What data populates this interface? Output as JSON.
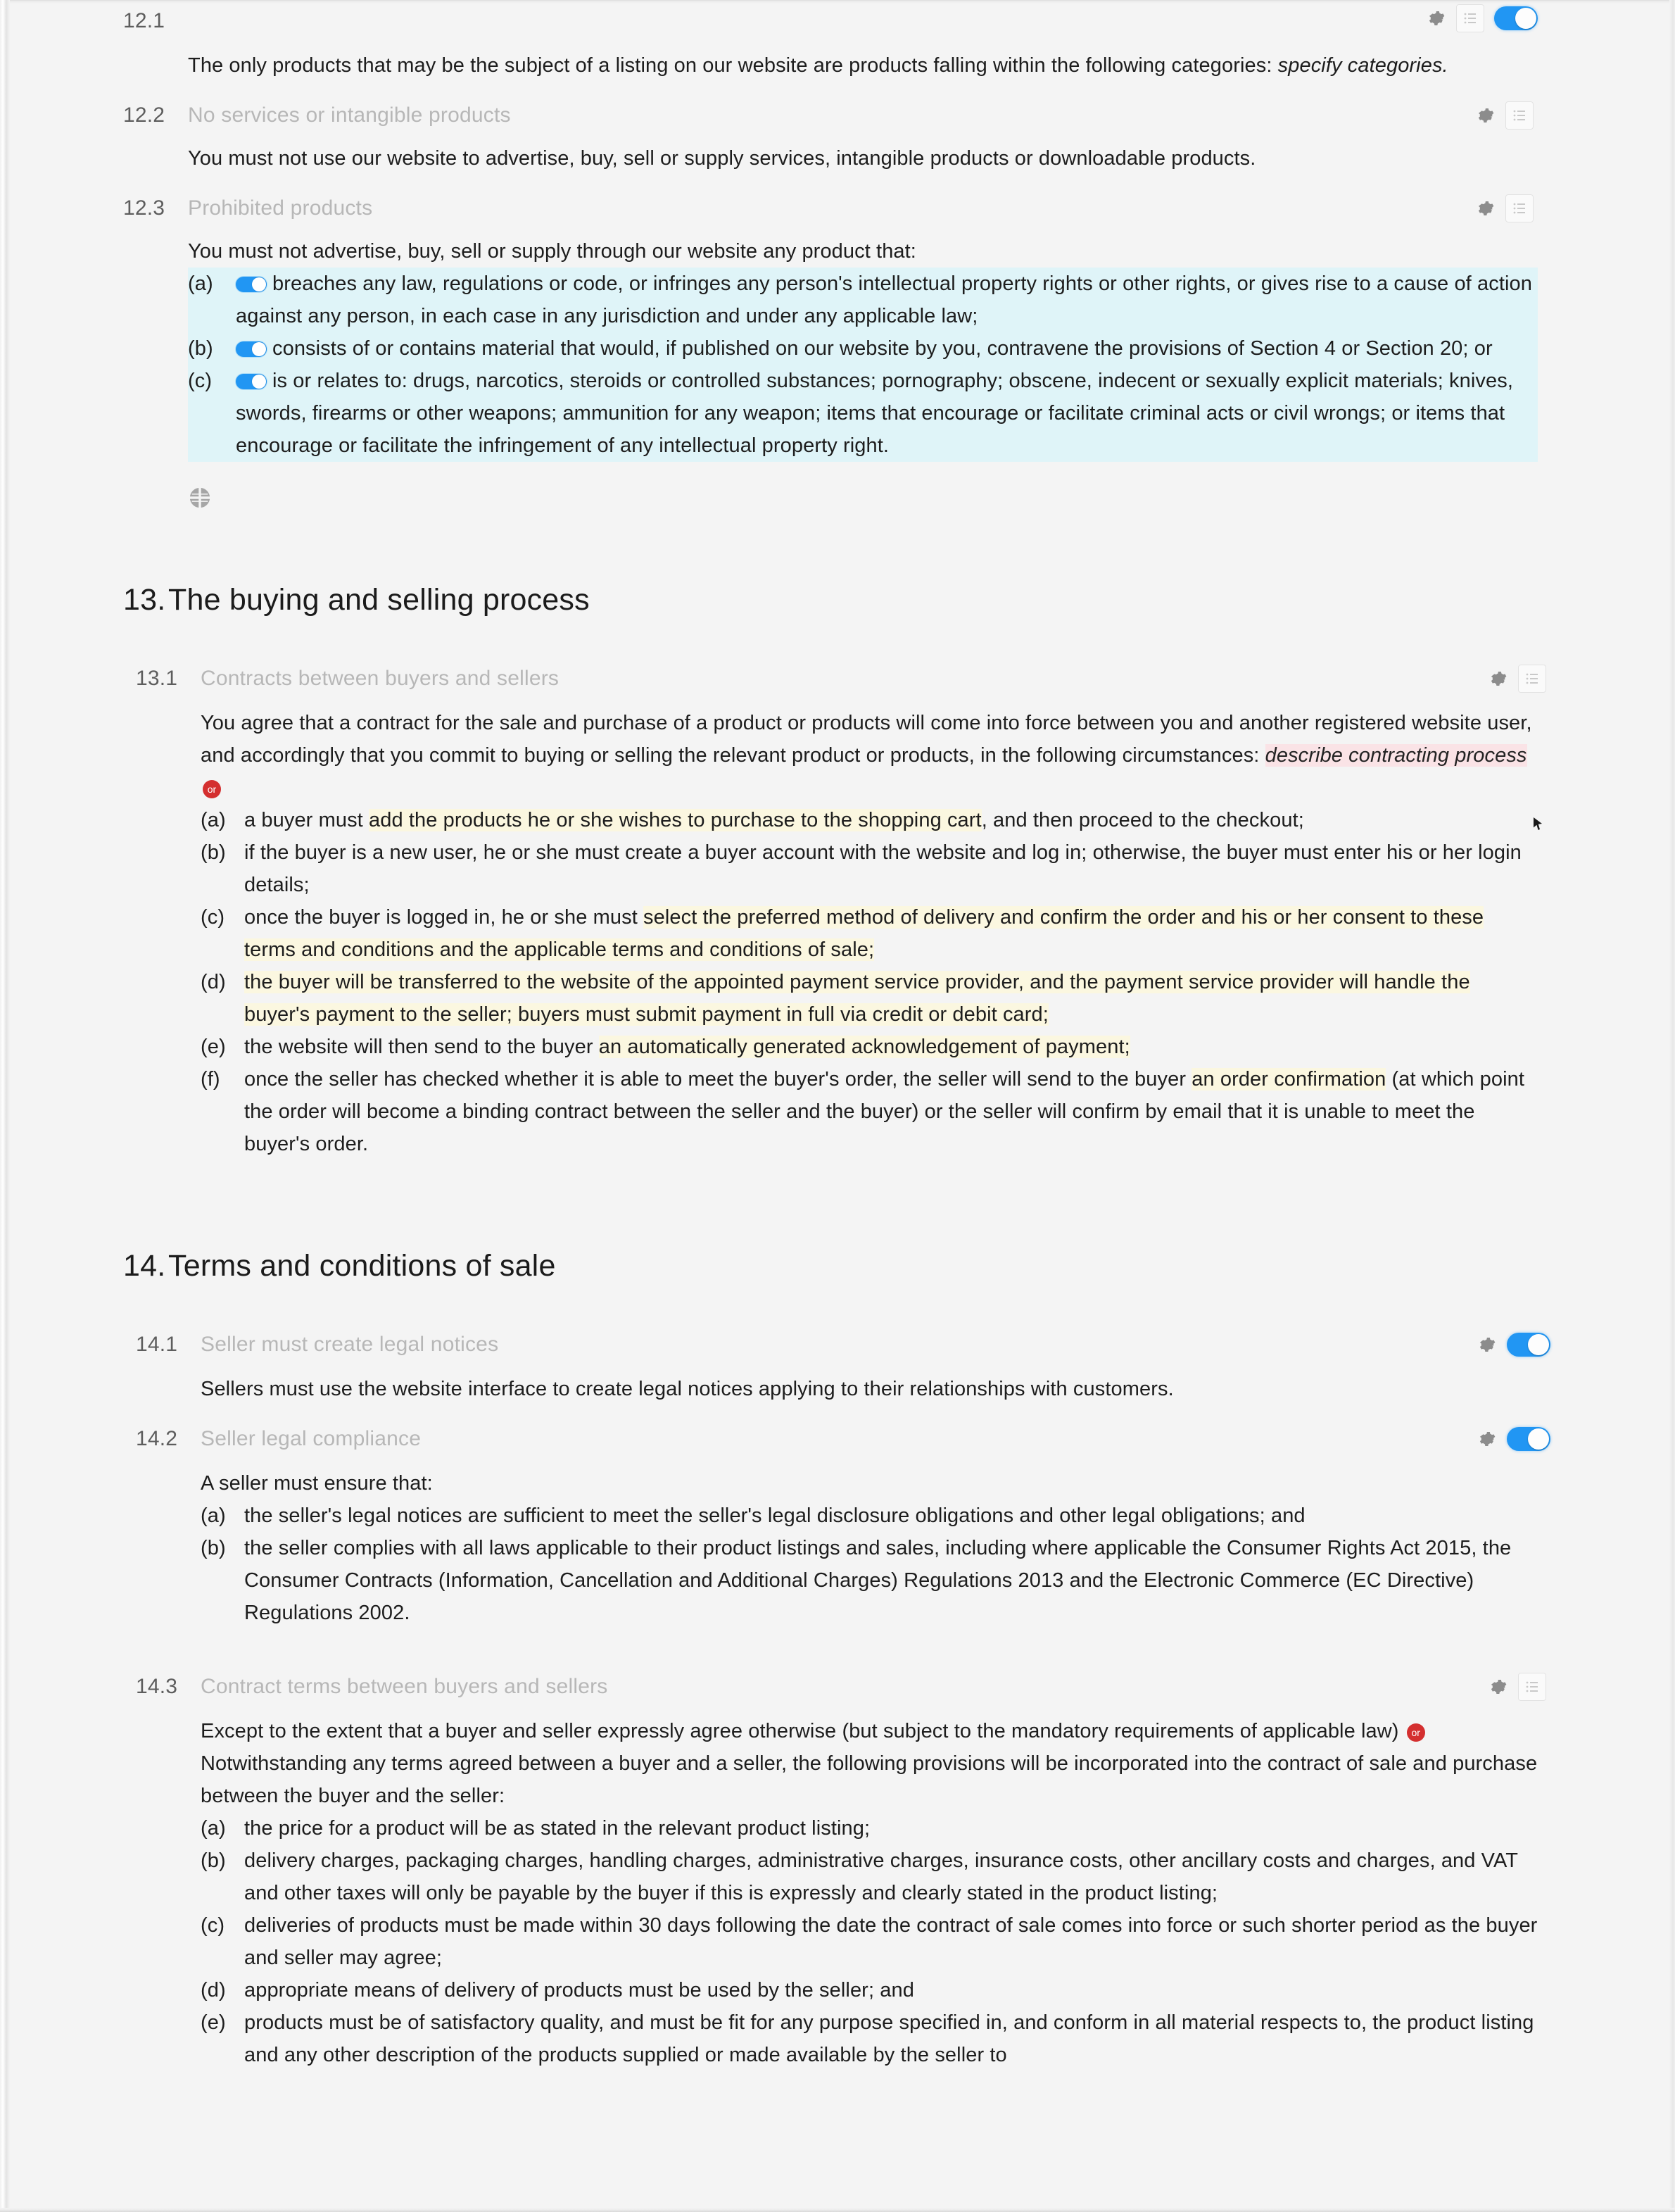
{
  "document": {
    "clauses": [
      {
        "number": "12.1",
        "title": "",
        "controls": [
          "gear-icon",
          "list-button",
          "toggle-on"
        ],
        "body_intro": "The only products that may be the subject of a listing on our website are products falling within the following categories: ",
        "body_italic": "specify categories."
      },
      {
        "number": "12.2",
        "title": "No services or intangible products",
        "controls": [
          "gear-icon",
          "list-button"
        ],
        "body": "You must not use our website to advertise, buy, sell or supply services, intangible products or downloadable products."
      },
      {
        "number": "12.3",
        "title": "Prohibited products",
        "controls": [
          "gear-icon",
          "list-button"
        ],
        "lead": "You must not advertise, buy, sell or supply through our website any product that:",
        "items": [
          {
            "marker": "(a)",
            "toggle": true,
            "text": "breaches any law, regulations or code, or infringes any person's intellectual property rights or other rights, or gives rise to a cause of action against any person, in each case in any jurisdiction and under any applicable law;"
          },
          {
            "marker": "(b)",
            "toggle": true,
            "text": "consists of or contains material that would, if published on our website by you, contravene the provisions of Section 4 or Section 20; or"
          },
          {
            "marker": "(c)",
            "toggle": true,
            "text": "is or relates to: drugs, narcotics, steroids or controlled substances; pornography; obscene, indecent or sexually explicit materials; knives, swords, firearms or other weapons; ammunition for any weapon; items that encourage or facilitate criminal acts or civil wrongs; or items that encourage or facilitate the infringement of any intellectual property right."
          }
        ],
        "footer_icon": "quadrant-icon"
      }
    ],
    "section_13": {
      "number": "13.",
      "title": "The buying and selling process",
      "clause": {
        "number": "13.1",
        "title": "Contracts between buyers and sellers",
        "controls": [
          "gear-icon",
          "list-button"
        ],
        "lead_plain": "You agree that a contract for the sale and purchase of a product or products will come into force between you and another registered website user, and accordingly that you commit to buying or selling the relevant product or products, in the following circumstances: ",
        "lead_italic": "describe contracting process",
        "or_badge": "or",
        "items": [
          {
            "marker": "(a)",
            "pre": "a buyer must ",
            "hl": "add the products he or she wishes to purchase to the shopping cart",
            "post": ", and then proceed to the checkout;"
          },
          {
            "marker": "(b)",
            "pre": "if the buyer is a new user, he or she must create a buyer account with the website and log in; otherwise, the buyer must enter his or her login details;",
            "hl": "",
            "post": ""
          },
          {
            "marker": "(c)",
            "pre": "once the buyer is logged in, he or she must ",
            "hl": "select the preferred method of delivery and confirm the order and his or her consent to these terms and conditions and the applicable terms and conditions of sale;",
            "post": ""
          },
          {
            "marker": "(d)",
            "pre": "",
            "hl": "the buyer will be transferred to the website of the appointed payment service provider, and the payment service provider will handle the buyer's payment to the seller; buyers must submit payment in full via credit or debit card;",
            "post": ""
          },
          {
            "marker": "(e)",
            "pre": "the website will then send to the buyer ",
            "hl": "an automatically generated acknowledgement of payment;",
            "post": ""
          },
          {
            "marker": "(f)",
            "pre": "once the seller has checked whether it is able to meet the buyer's order, the seller will send to the buyer ",
            "hl": "an order confirmation",
            "post": " (at which point the order will become a binding contract between the seller and the buyer) or the seller will confirm by email that it is unable to meet the buyer's order."
          }
        ]
      }
    },
    "section_14": {
      "number": "14.",
      "title": "Terms and conditions of sale",
      "clauses": [
        {
          "number": "14.1",
          "title": "Seller must create legal notices",
          "controls": [
            "gear-icon",
            "toggle-on"
          ],
          "body": "Sellers must use the website interface to create legal notices applying to their relationships with customers."
        },
        {
          "number": "14.2",
          "title": "Seller legal compliance",
          "controls": [
            "gear-icon",
            "toggle-on"
          ],
          "lead": "A seller must ensure that:",
          "items": [
            {
              "marker": "(a)",
              "text": "the seller's legal notices are sufficient to meet the seller's legal disclosure obligations and other legal obligations; and"
            },
            {
              "marker": "(b)",
              "text": "the seller complies with all laws applicable to their product listings and sales, including where applicable the Consumer Rights Act 2015, the Consumer Contracts (Information, Cancellation and Additional Charges) Regulations 2013 and the Electronic Commerce (EC Directive) Regulations 2002."
            }
          ]
        },
        {
          "number": "14.3",
          "title": "Contract terms between buyers and sellers",
          "controls": [
            "gear-icon",
            "list-button"
          ],
          "lead_a": "Except to the extent that a buyer and seller expressly agree otherwise (but subject to the mandatory requirements of applicable law) ",
          "or_badge": "or",
          "lead_b": " Notwithstanding any terms agreed between a buyer and a seller, the following provisions will be incorporated into the contract of sale and purchase between the buyer and the seller:",
          "items": [
            {
              "marker": "(a)",
              "text": "the price for a product will be as stated in the relevant product listing;"
            },
            {
              "marker": "(b)",
              "text": "delivery charges, packaging charges, handling charges, administrative charges, insurance costs, other ancillary costs and charges, and VAT and other taxes will only be payable by the buyer if this is expressly and clearly stated in the product listing;"
            },
            {
              "marker": "(c)",
              "text": "deliveries of products must be made within 30 days following the date the contract of sale comes into force or such shorter period as the buyer and seller may agree;"
            },
            {
              "marker": "(d)",
              "text": "appropriate means of delivery of products must be used by the seller; and"
            },
            {
              "marker": "(e)",
              "text": "products must be of satisfactory quality, and must be fit for any purpose specified in, and conform in all material respects to, the product listing and any other description of the products supplied or made available by the seller to"
            }
          ]
        }
      ]
    }
  },
  "colors": {
    "accent_toggle": "#2196f3",
    "highlight_blue": "#dff4f8",
    "highlight_yellow": "#fbf7e0",
    "highlight_pink": "#fae3e6",
    "or_badge_red": "#d42f2f",
    "clause_title_grey": "#b7b7b7",
    "page_background": "#f4f4f4"
  }
}
